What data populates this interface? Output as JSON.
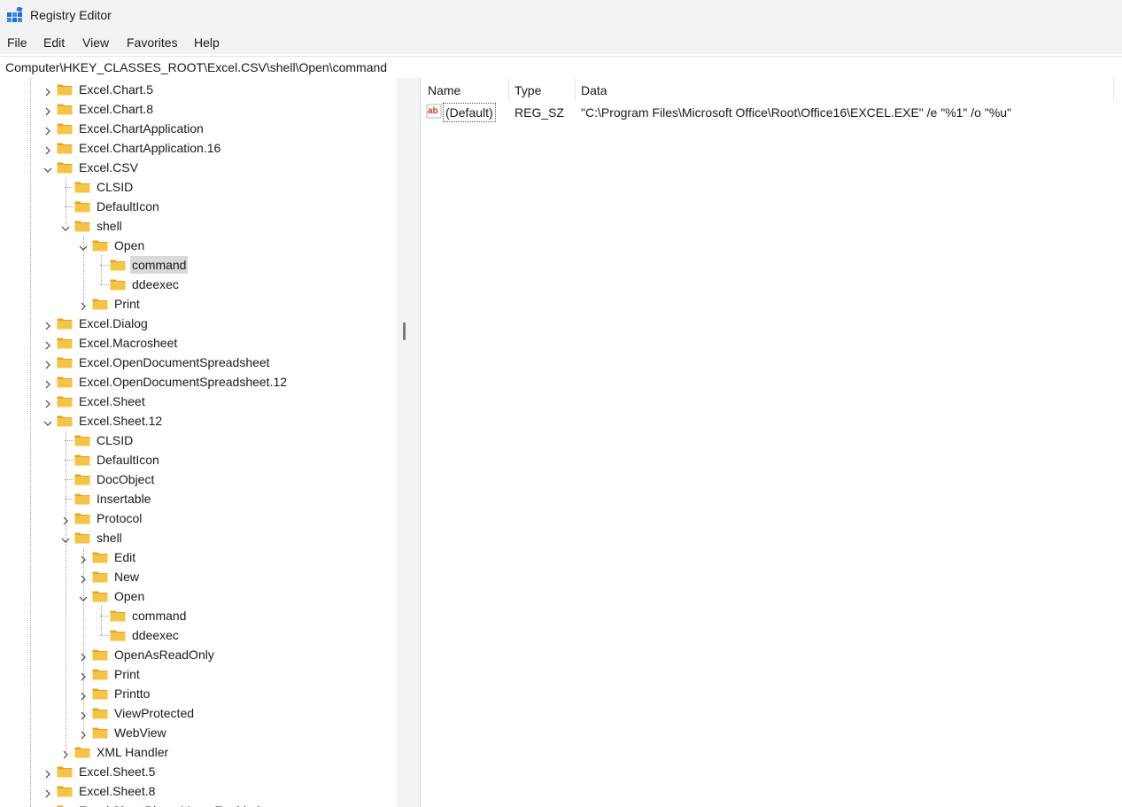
{
  "window": {
    "title": "Registry Editor"
  },
  "menu": [
    "File",
    "Edit",
    "View",
    "Favorites",
    "Help"
  ],
  "address": "Computer\\HKEY_CLASSES_ROOT\\Excel.CSV\\shell\\Open\\command",
  "tree": [
    {
      "label": "Excel.Chart.5",
      "level": 0,
      "state": "collapsed"
    },
    {
      "label": "Excel.Chart.8",
      "level": 0,
      "state": "collapsed"
    },
    {
      "label": "Excel.ChartApplication",
      "level": 0,
      "state": "collapsed"
    },
    {
      "label": "Excel.ChartApplication.16",
      "level": 0,
      "state": "collapsed"
    },
    {
      "label": "Excel.CSV",
      "level": 0,
      "state": "expanded"
    },
    {
      "label": "CLSID",
      "level": 1,
      "state": "leaf"
    },
    {
      "label": "DefaultIcon",
      "level": 1,
      "state": "leaf"
    },
    {
      "label": "shell",
      "level": 1,
      "state": "expanded"
    },
    {
      "label": "Open",
      "level": 2,
      "state": "expanded"
    },
    {
      "label": "command",
      "level": 3,
      "state": "leaf",
      "selected": true
    },
    {
      "label": "ddeexec",
      "level": 3,
      "state": "leaf"
    },
    {
      "label": "Print",
      "level": 2,
      "state": "collapsed"
    },
    {
      "label": "Excel.Dialog",
      "level": 0,
      "state": "collapsed"
    },
    {
      "label": "Excel.Macrosheet",
      "level": 0,
      "state": "collapsed"
    },
    {
      "label": "Excel.OpenDocumentSpreadsheet",
      "level": 0,
      "state": "collapsed"
    },
    {
      "label": "Excel.OpenDocumentSpreadsheet.12",
      "level": 0,
      "state": "collapsed"
    },
    {
      "label": "Excel.Sheet",
      "level": 0,
      "state": "collapsed"
    },
    {
      "label": "Excel.Sheet.12",
      "level": 0,
      "state": "expanded"
    },
    {
      "label": "CLSID",
      "level": 1,
      "state": "leaf"
    },
    {
      "label": "DefaultIcon",
      "level": 1,
      "state": "leaf"
    },
    {
      "label": "DocObject",
      "level": 1,
      "state": "leaf"
    },
    {
      "label": "Insertable",
      "level": 1,
      "state": "leaf"
    },
    {
      "label": "Protocol",
      "level": 1,
      "state": "collapsed"
    },
    {
      "label": "shell",
      "level": 1,
      "state": "expanded"
    },
    {
      "label": "Edit",
      "level": 2,
      "state": "collapsed"
    },
    {
      "label": "New",
      "level": 2,
      "state": "collapsed"
    },
    {
      "label": "Open",
      "level": 2,
      "state": "expanded"
    },
    {
      "label": "command",
      "level": 3,
      "state": "leaf"
    },
    {
      "label": "ddeexec",
      "level": 3,
      "state": "leaf"
    },
    {
      "label": "OpenAsReadOnly",
      "level": 2,
      "state": "collapsed"
    },
    {
      "label": "Print",
      "level": 2,
      "state": "collapsed"
    },
    {
      "label": "Printto",
      "level": 2,
      "state": "collapsed"
    },
    {
      "label": "ViewProtected",
      "level": 2,
      "state": "collapsed"
    },
    {
      "label": "WebView",
      "level": 2,
      "state": "collapsed"
    },
    {
      "label": "XML Handler",
      "level": 1,
      "state": "collapsed"
    },
    {
      "label": "Excel.Sheet.5",
      "level": 0,
      "state": "collapsed"
    },
    {
      "label": "Excel.Sheet.8",
      "level": 0,
      "state": "collapsed"
    },
    {
      "label": "Excel.SheetBinaryMacroEnabled",
      "level": 0,
      "state": "collapsed"
    }
  ],
  "list": {
    "columns": [
      "Name",
      "Type",
      "Data"
    ],
    "rows": [
      {
        "icon": "string-value-icon",
        "name": "(Default)",
        "type": "REG_SZ",
        "data": "\"C:\\Program Files\\Microsoft Office\\Root\\Office16\\EXCEL.EXE\" /e \"%1\" /o \"%u\""
      }
    ]
  },
  "colors": {
    "chrome": "#f3f3f3",
    "selection": "#d9d9d9",
    "folder": "#f5c445",
    "folder_dark": "#e0a42a",
    "value_icon_red": "#d23b2a"
  }
}
